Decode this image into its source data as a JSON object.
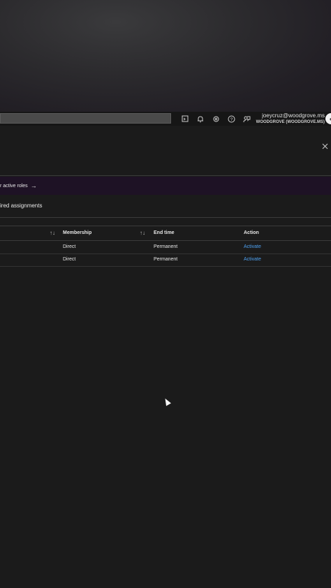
{
  "topbar": {
    "user_email": "joeycruz@woodgrove.ms",
    "user_tenant": "WOODGROVE (WOODGROVE.MS)",
    "icons": [
      "cloud-shell-icon",
      "bell-icon",
      "gear-icon",
      "help-icon",
      "feedback-icon"
    ]
  },
  "banner": {
    "text": "r active roles",
    "arrow": "→"
  },
  "tab": {
    "label": "ired assignments"
  },
  "table": {
    "headers": {
      "membership": "Membership",
      "end_time": "End time",
      "action": "Action"
    },
    "rows": [
      {
        "membership": "Direct",
        "end_time": "Permanent",
        "action": "Activate"
      },
      {
        "membership": "Direct",
        "end_time": "Permanent",
        "action": "Activate"
      }
    ]
  },
  "colors": {
    "link": "#4ea1f0",
    "banner_bg": "#1e1225",
    "page_bg": "#1b1b1b"
  }
}
